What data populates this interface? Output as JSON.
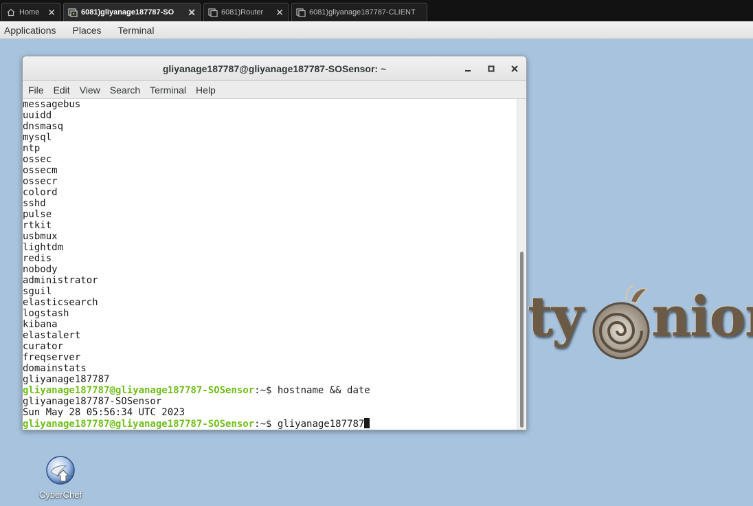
{
  "browser_tabs": [
    {
      "label": "Home",
      "icon": "home-icon",
      "active": false
    },
    {
      "label": "6081)gliyanage187787-SO",
      "icon": "remote-console-icon",
      "active": true
    },
    {
      "label": "6081)Router",
      "icon": "copy-window-icon",
      "active": false
    },
    {
      "label": "6081)gliyanage187787-CLIENT",
      "icon": "copy-window-icon",
      "active": false
    }
  ],
  "panel": {
    "applications": "Applications",
    "places": "Places",
    "terminal": "Terminal"
  },
  "window": {
    "title": "gliyanage187787@gliyanage187787-SOSensor: ~",
    "minimize": "_",
    "maximize": "□",
    "close": "×"
  },
  "menubar": [
    "File",
    "Edit",
    "View",
    "Search",
    "Terminal",
    "Help"
  ],
  "terminal": {
    "lines": [
      "messagebus",
      "uuidd",
      "dnsmasq",
      "mysql",
      "ntp",
      "ossec",
      "ossecm",
      "ossecr",
      "colord",
      "sshd",
      "pulse",
      "rtkit",
      "usbmux",
      "lightdm",
      "redis",
      "nobody",
      "administrator",
      "sguil",
      "elasticsearch",
      "logstash",
      "kibana",
      "elastalert",
      "curator",
      "freqserver",
      "domainstats",
      "gliyanage187787"
    ],
    "prompt_user_host": "gliyanage187787@gliyanage187787-SOSensor",
    "prompt_path": ":~",
    "prompt_symbol": "$ ",
    "command_1": "hostname && date",
    "output_1": "gliyanage187787-SOSensor",
    "output_2": "Sun May 28 05:56:34 UTC 2023",
    "current_input": "gliyanage187787"
  },
  "desktop": {
    "logo_left": "ty",
    "logo_right": "nion",
    "cyberchef_label": "CyberChef"
  },
  "colors": {
    "desktop_bg": "#a7c3de",
    "prompt_green": "#6fbe1a",
    "prompt_blue": "#3465a4"
  }
}
